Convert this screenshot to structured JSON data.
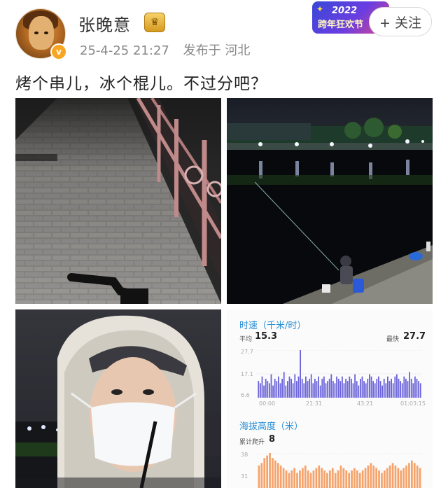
{
  "user": {
    "name": "张晚意",
    "medal_icon": "crown-medal-icon",
    "verified_icon": "v-badge-icon",
    "verified_glyph": "v",
    "time": "25-4-25 21:27",
    "source": "发布于 河北"
  },
  "promo": {
    "year": "2022",
    "name": "跨年狂欢节"
  },
  "follow": {
    "label": "+ 关注"
  },
  "post": {
    "text": "烤个串儿，冰个棍儿。不过分吧？"
  },
  "photos": [
    {
      "icon": "sidewalk-railing-night-photo"
    },
    {
      "icon": "river-night-fishing-photo"
    },
    {
      "icon": "selfie-mask-hood-photo"
    }
  ],
  "colors": {
    "accent": "#2a8fd6",
    "speed_bar": "#6b63d9",
    "altitude_bar": "#f5a36b",
    "follow_border": "#d8d8d8"
  },
  "speed_chart": {
    "title": "时速（千米/时）",
    "avg_label": "平均",
    "avg_value": "15.3",
    "max_label": "最快",
    "max_value": "27.7",
    "ytick_top": "27.7",
    "ytick_mid": "17.1",
    "ytick_bottom": "6.6",
    "xticks": [
      "00:00",
      "21:31",
      "43:21",
      "01:03:15"
    ]
  },
  "altitude_chart": {
    "title": "海拔高度（米）",
    "gain_label": "累计爬升",
    "gain_value": "8",
    "ytick_top": "38",
    "ytick_mid": "31"
  },
  "chart_data": [
    {
      "type": "bar",
      "title": "时速（千米/时）",
      "ylim": [
        6.6,
        27.7
      ],
      "xticks": [
        "00:00",
        "21:31",
        "43:21",
        "01:03:15"
      ],
      "values": [
        14,
        13,
        16,
        12,
        15,
        14,
        13,
        17,
        12,
        15,
        14,
        16,
        13,
        15,
        18,
        12,
        14,
        16,
        15,
        13,
        17,
        14,
        16,
        27.7,
        15,
        13,
        16,
        14,
        15,
        17,
        13,
        15,
        14,
        16,
        12,
        15,
        16,
        13,
        14,
        15,
        17,
        14,
        13,
        16,
        15,
        14,
        16,
        13,
        15,
        14,
        16,
        15,
        13,
        17,
        14,
        12,
        15,
        16,
        14,
        13,
        15,
        17,
        16,
        14,
        13,
        15,
        16,
        14,
        12,
        15,
        13,
        16,
        14,
        15,
        13,
        16,
        17,
        15,
        14,
        13,
        16,
        15,
        14,
        18,
        15,
        13,
        16,
        15,
        14,
        13
      ]
    },
    {
      "type": "bar",
      "title": "海拔高度（米）",
      "ylim": [
        24,
        38
      ],
      "values": [
        33,
        34,
        36,
        37,
        38,
        36,
        35,
        34,
        33,
        32,
        31,
        30,
        31,
        32,
        30,
        31,
        32,
        33,
        31,
        30,
        31,
        32,
        33,
        32,
        31,
        30,
        31,
        32,
        30,
        31,
        33,
        32,
        31,
        30,
        31,
        32,
        31,
        30,
        31,
        32,
        33,
        34,
        33,
        32,
        31,
        30,
        31,
        32,
        33,
        34,
        33,
        32,
        31,
        32,
        33,
        34,
        35,
        34,
        33,
        32
      ]
    }
  ]
}
